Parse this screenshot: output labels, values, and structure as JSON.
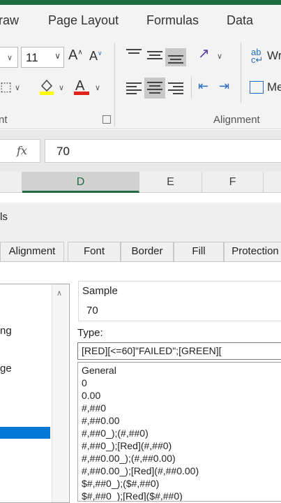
{
  "ribbon": {
    "tabs": [
      "raw",
      "Page Layout",
      "Formulas",
      "Data"
    ],
    "font_size": "11",
    "font_group_label": "nt",
    "alignment_group_label": "Alignment",
    "wrap_text_partial": "Wr",
    "merge_partial": "Me"
  },
  "formula_bar": {
    "fx_label": "fx",
    "value": "70"
  },
  "columns": [
    "D",
    "E",
    "F"
  ],
  "dialog": {
    "title_partial": "ls",
    "tabs": [
      "Alignment",
      "Font",
      "Border",
      "Fill",
      "Protection"
    ],
    "category_items": [
      "ng",
      "ge"
    ],
    "sample_label": "Sample",
    "sample_value": "70",
    "type_label": "Type:",
    "type_value": "[RED][<=60]\"FAILED\";[GREEN][",
    "format_codes": [
      "General",
      "0",
      "0.00",
      "#,##0",
      "#,##0.00",
      "#,##0_);(#,##0)",
      "#,##0_);[Red](#,##0)",
      "#,##0.00_);(#,##0.00)",
      "#,##0.00_);[Red](#,##0.00)",
      "$#,##0_);($#,##0)",
      "$#,##0_);[Red]($#,##0)"
    ]
  },
  "colors": {
    "accent_green": "#1e6c41",
    "selection_blue": "#0078d4",
    "font_color_red": "#e2231a",
    "highlight_yellow": "#ffff00"
  }
}
